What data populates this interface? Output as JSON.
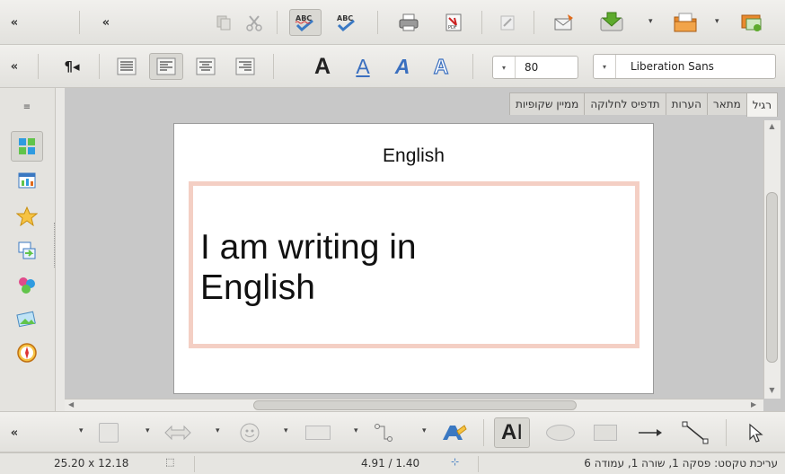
{
  "toolbar_standard": {
    "overflow_left": "«",
    "overflow_right": "«",
    "buttons": [
      "copy-icon",
      "cut-icon",
      "autospellcheck-icon",
      "spellcheck-icon",
      "print-icon",
      "export-pdf-icon",
      "edit-icon",
      "send-icon",
      "save-icon",
      "open-icon",
      "new-icon"
    ]
  },
  "toolbar_format": {
    "overflow": "«",
    "paragraph_marker": "¶◂",
    "font_size": "80",
    "font_name": "Liberation Sans",
    "font_glyph": "A"
  },
  "tabs": [
    "רגיל",
    "מתאר",
    "הערות",
    "תדפיס לחלוקה",
    "ממיין שקופיות"
  ],
  "slide": {
    "title": "English",
    "body_line1": "I am writing in",
    "body_line2": "English"
  },
  "toolbar_drawing": {
    "overflow": "«",
    "text_glyph": "A"
  },
  "status": {
    "size": "25.20 x 12.18",
    "position": "4.91 / 1.40",
    "edit_state": "עריכת טקסט: פסקה 1, שורה 1, עמודה 6"
  },
  "colors": {
    "textbox_border": "#f4cfc4",
    "toolbar_bg": "#e9e8e5"
  }
}
